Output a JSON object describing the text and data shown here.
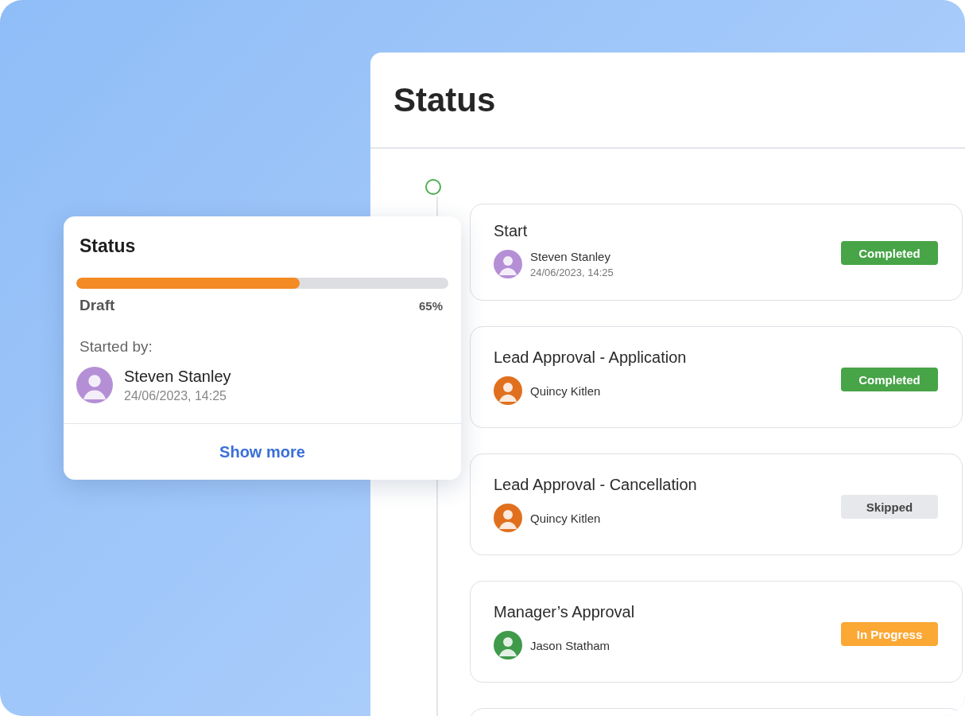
{
  "panel": {
    "title": "Status"
  },
  "steps": [
    {
      "title": "Start",
      "assignee": {
        "name": "Steven Stanley",
        "date": "24/06/2023, 14:25",
        "color": "#b58fd6"
      },
      "badge": {
        "kind": "completed",
        "label": "Completed"
      }
    },
    {
      "title": "Lead Approval - Application",
      "assignee": {
        "name": "Quincy Kitlen",
        "color": "#e0701e"
      },
      "badge": {
        "kind": "completed",
        "label": "Completed"
      }
    },
    {
      "title": "Lead Approval - Cancellation",
      "assignee": {
        "name": "Quincy Kitlen",
        "color": "#e0701e"
      },
      "badge": {
        "kind": "skipped",
        "label": "Skipped"
      }
    },
    {
      "title": "Manager’s Approval",
      "assignee": {
        "name": "Jason Statham",
        "color": "#3f9a4a"
      },
      "badge": {
        "kind": "in_progress",
        "label": "In Progress"
      }
    }
  ],
  "popup": {
    "title": "Status",
    "level": 0.6,
    "stage": "Draft",
    "percent": "65%",
    "started_label": "Started by:",
    "starter": {
      "name": "Steven Stanley",
      "date": "24/06/2023, 14:25",
      "color": "#b58fd6"
    },
    "link": "Show more"
  }
}
